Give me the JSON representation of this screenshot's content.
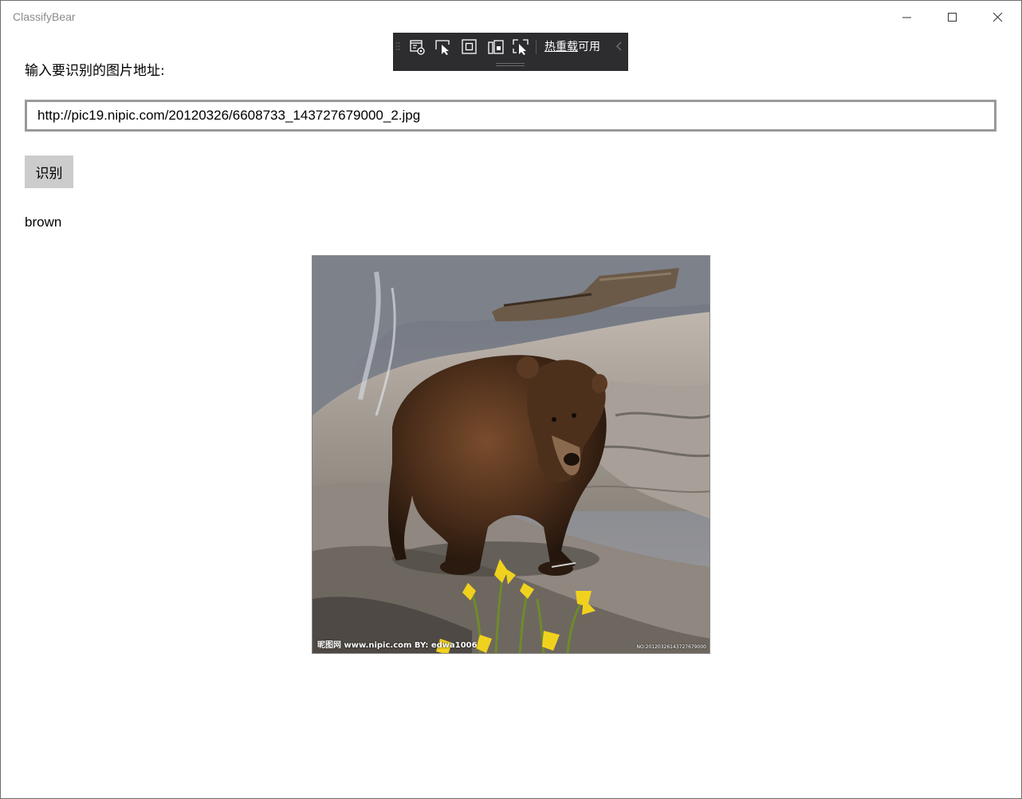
{
  "window": {
    "title": "ClassifyBear",
    "controls": {
      "minimize_icon": "minimize-icon",
      "maximize_icon": "maximize-icon",
      "close_icon": "close-icon"
    }
  },
  "dev_toolbar": {
    "tools": [
      "live-visual-tree-icon",
      "select-element-icon",
      "display-layout-adorners-icon",
      "track-focus-icon",
      "preview-selection-icon"
    ],
    "hot_reload_prefix": "热重载",
    "hot_reload_suffix": "可用",
    "collapse_icon": "chevron-left-icon"
  },
  "form": {
    "prompt": "输入要识别的图片地址:",
    "url_value": "http://pic19.nipic.com/20120326/6608733_143727679000_2.jpg",
    "recognize_label": "识别"
  },
  "result": {
    "label": "brown"
  },
  "photo": {
    "description_icon": "bear-photo",
    "watermark_left": "昵图网 www.nipic.com   BY: edwa1006",
    "watermark_right": "NO:20120326143727679000"
  },
  "colors": {
    "toolbar_bg": "#2d2d30",
    "input_border": "#9a9a9a",
    "button_bg": "#cccccc"
  }
}
